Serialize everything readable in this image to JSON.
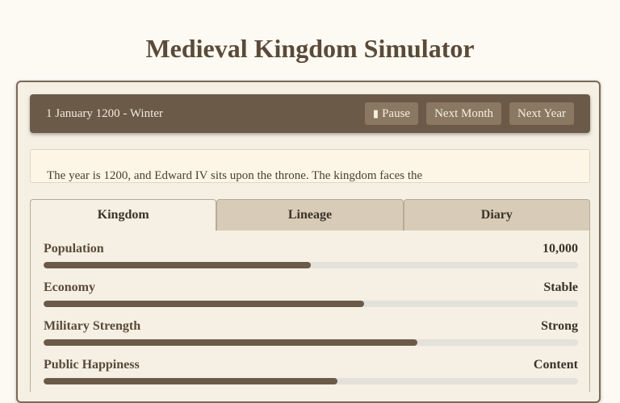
{
  "title": "Medieval Kingdom Simulator",
  "toolbar": {
    "date": "1 January 1200 - Winter",
    "pause_icon": "pause-icon",
    "pause_label": "Pause",
    "next_month_label": "Next Month",
    "next_year_label": "Next Year"
  },
  "message": "The year is 1200, and Edward IV sits upon the throne. The kingdom faces the",
  "tabs": [
    {
      "label": "Kingdom",
      "active": true
    },
    {
      "label": "Lineage",
      "active": false
    },
    {
      "label": "Diary",
      "active": false
    }
  ],
  "stats": [
    {
      "label": "Population",
      "value": "10,000",
      "level": 0.5
    },
    {
      "label": "Economy",
      "value": "Stable",
      "level": 0.6
    },
    {
      "label": "Military Strength",
      "value": "Strong",
      "level": 0.7
    },
    {
      "label": "Public Happiness",
      "value": "Content",
      "level": 0.55
    }
  ],
  "colors": {
    "accent": "#6b5a48",
    "button": "#8a7862",
    "tab_inactive": "#d8ccb8",
    "background": "#f5efe4"
  }
}
